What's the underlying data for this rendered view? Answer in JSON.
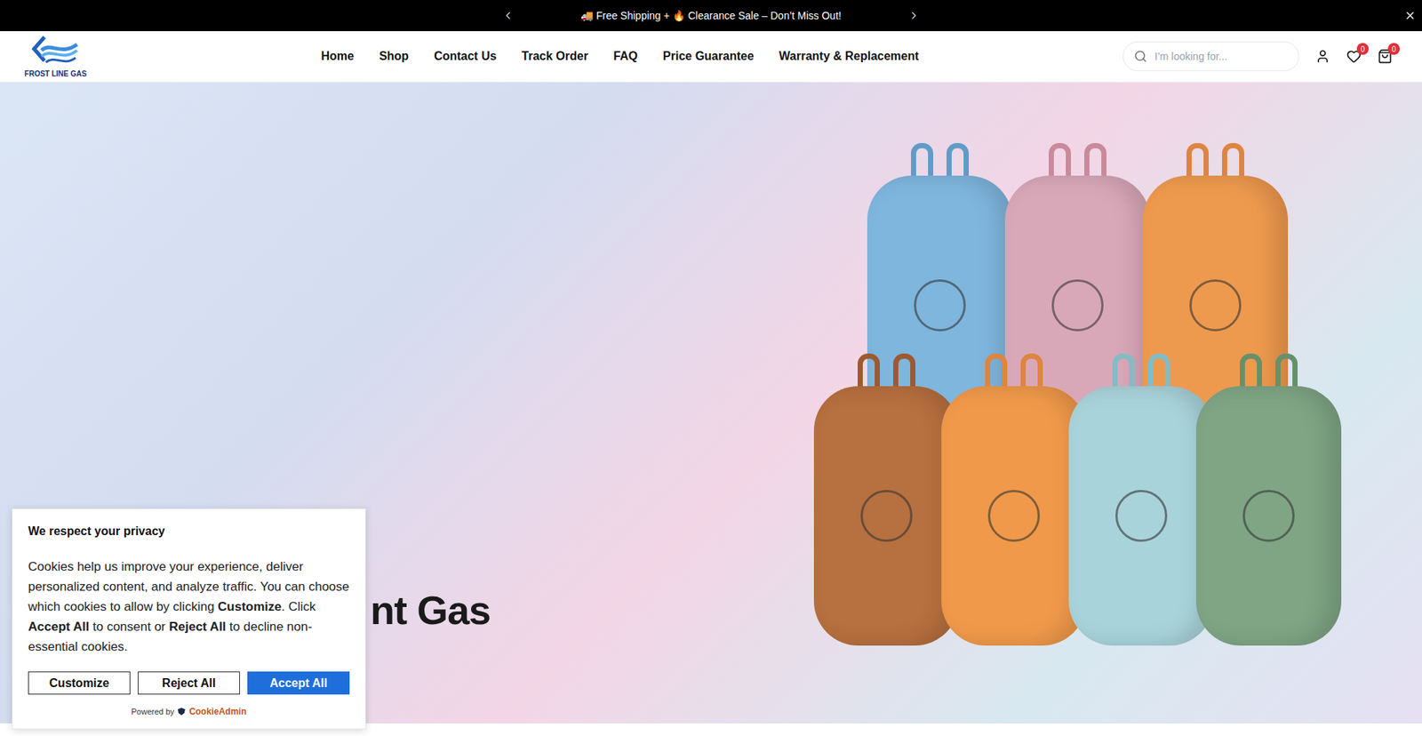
{
  "announcement": {
    "text": "🚚 Free Shipping + 🔥 Clearance Sale – Don’t Miss Out!"
  },
  "logo": {
    "text": "FROST LINE GAS"
  },
  "nav": [
    "Home",
    "Shop",
    "Contact Us",
    "Track Order",
    "FAQ",
    "Price Guarantee",
    "Warranty & Replacement"
  ],
  "search": {
    "placeholder": "I’m looking for..."
  },
  "wishlist": {
    "count": "0"
  },
  "cart": {
    "count": "0"
  },
  "hero": {
    "title": "nt Gas"
  },
  "cookie_banner": {
    "title": "We respect your privacy",
    "body": [
      {
        "text": "Cookies help us improve your experience, deliver personalized content, and analyze traffic. You can choose which cookies to allow by clicking ",
        "bold": false
      },
      {
        "text": "Customize",
        "bold": true
      },
      {
        "text": ". Click ",
        "bold": false
      },
      {
        "text": "Accept All",
        "bold": true
      },
      {
        "text": " to consent or ",
        "bold": false
      },
      {
        "text": "Reject All",
        "bold": true
      },
      {
        "text": " to decline non-essential cookies.",
        "bold": false
      }
    ],
    "buttons": [
      {
        "label": "Customize",
        "primary": false
      },
      {
        "label": "Reject All",
        "primary": false
      },
      {
        "label": "Accept All",
        "primary": true
      }
    ],
    "powered_by": "Powered by",
    "brand": "CookieAdmin"
  }
}
